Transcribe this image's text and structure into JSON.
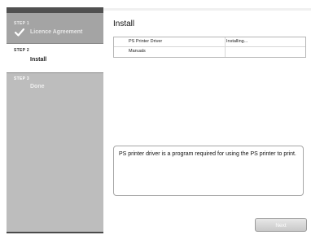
{
  "sidebar": {
    "steps": [
      {
        "number": "STEP 1",
        "label": "Licence Agreement",
        "status": "completed",
        "icon": "check-icon"
      },
      {
        "number": "STEP 2",
        "label": "Install",
        "status": "current"
      },
      {
        "number": "STEP 3",
        "label": "Done",
        "status": "pending"
      }
    ]
  },
  "main": {
    "title": "Install",
    "components": [
      {
        "name": "PS Printer Driver",
        "status": "Installing..."
      },
      {
        "name": "Manuals",
        "status": ""
      }
    ],
    "description": "PS printer driver is a program required for using the PS printer to print."
  },
  "footer": {
    "next_label": "Next",
    "next_enabled": false
  }
}
